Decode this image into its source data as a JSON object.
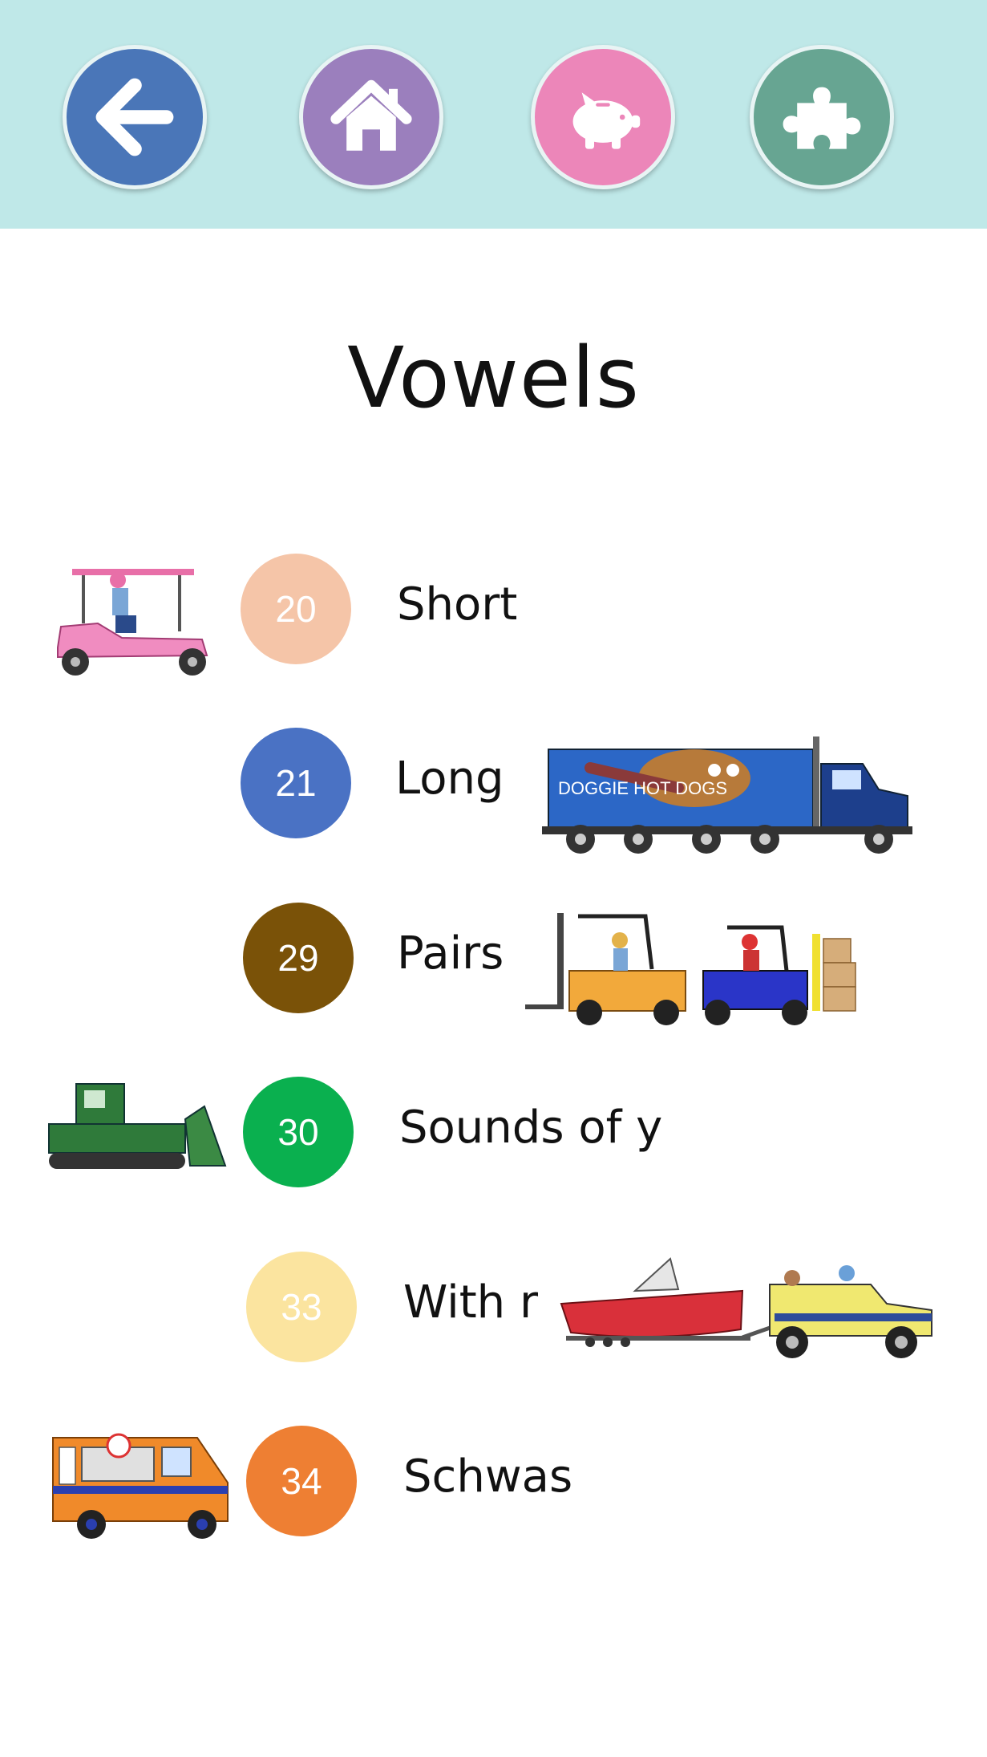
{
  "nav": {
    "buttons": [
      {
        "name": "back",
        "icon": "arrow-left-icon",
        "color": "#4a76b8"
      },
      {
        "name": "home",
        "icon": "home-icon",
        "color": "#9b7fbd"
      },
      {
        "name": "savings",
        "icon": "piggy-bank-icon",
        "color": "#ec86b9"
      },
      {
        "name": "puzzle",
        "icon": "puzzle-icon",
        "color": "#67a592"
      }
    ],
    "background": "#bfe8e8"
  },
  "page": {
    "title": "Vowels"
  },
  "lessons": [
    {
      "number": "20",
      "label": "Short",
      "color": "#f5c5a8",
      "vehicle": "golf-cart-icon"
    },
    {
      "number": "21",
      "label": "Long",
      "color": "#4a72c4",
      "vehicle": "hot-dog-truck-icon",
      "vehicle_text": "DOGGIE HOT DOGS"
    },
    {
      "number": "29",
      "label": "Pairs",
      "color": "#7a5208",
      "vehicle": "forklifts-icon"
    },
    {
      "number": "30",
      "label": "Sounds of y",
      "color": "#0ab04f",
      "vehicle": "bulldozer-icon"
    },
    {
      "number": "33",
      "label": "With r",
      "color": "#fbe49f",
      "vehicle": "truck-with-boat-icon"
    },
    {
      "number": "34",
      "label": "Schwas",
      "color": "#ee7f33",
      "vehicle": "ice-cream-van-icon"
    }
  ]
}
